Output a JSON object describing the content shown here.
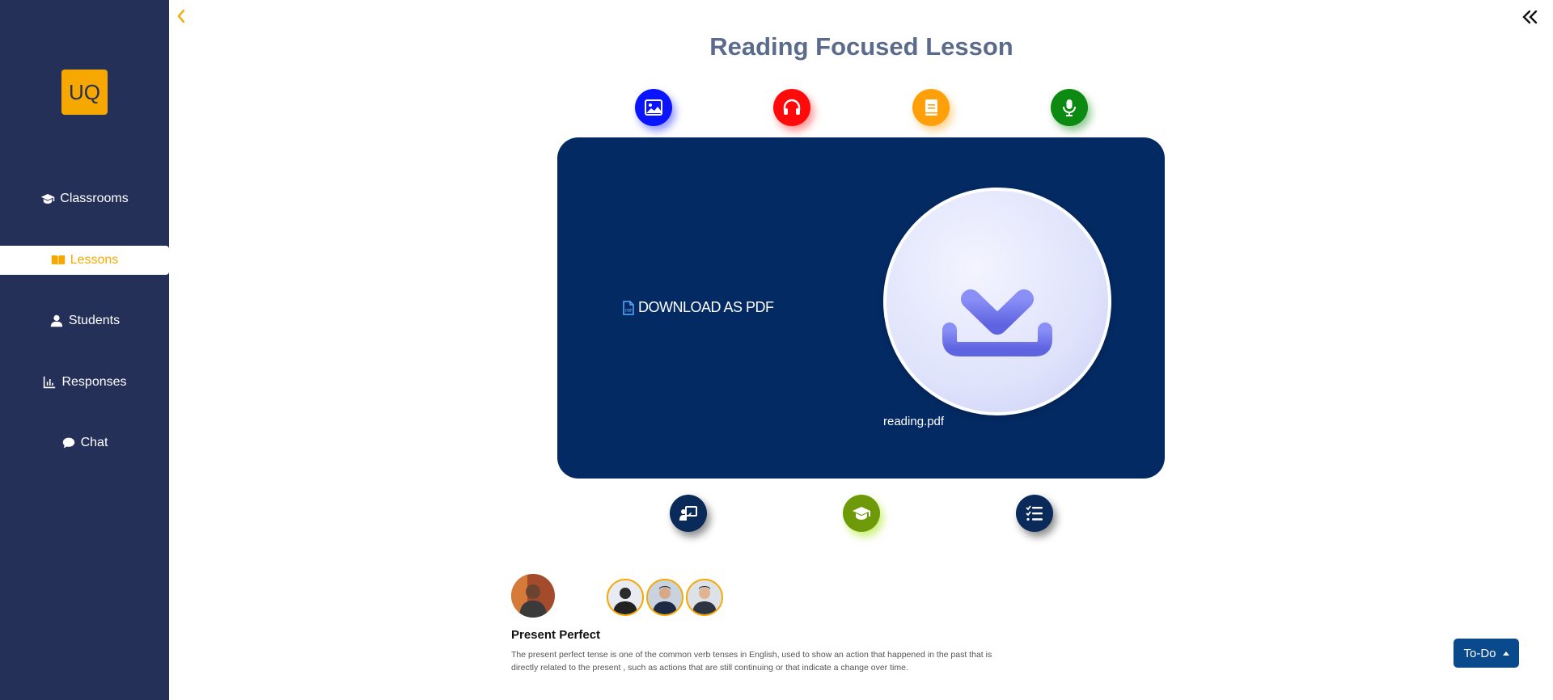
{
  "sidebar": {
    "logo": "UQ",
    "items": [
      {
        "label": "Classrooms",
        "icon": "graduation-cap-icon"
      },
      {
        "label": "Lessons",
        "icon": "book-open-icon",
        "active": true
      },
      {
        "label": "Students",
        "icon": "user-icon"
      },
      {
        "label": "Responses",
        "icon": "chart-bar-icon"
      },
      {
        "label": "Chat",
        "icon": "comment-icon"
      }
    ]
  },
  "page": {
    "title": "Reading Focused Lesson"
  },
  "top_icons": [
    {
      "name": "image-icon",
      "color": "#0a14ff"
    },
    {
      "name": "headphones-icon",
      "color": "#ff0a0a"
    },
    {
      "name": "book-icon",
      "color": "#ff9f0a"
    },
    {
      "name": "microphone-icon",
      "color": "#0d8a12"
    }
  ],
  "card": {
    "download_label": "DOWNLOAD AS PDF",
    "filename": "reading.pdf",
    "background": "#042a63"
  },
  "bottom_icons": [
    {
      "name": "teacher-board-icon",
      "color": "#0a2a5a"
    },
    {
      "name": "graduation-cap-icon",
      "color": "#6e9a0a"
    },
    {
      "name": "task-list-icon",
      "color": "#0a2a5a"
    }
  ],
  "lesson": {
    "title": "Present Perfect",
    "description": "The present perfect tense is one of the common verb tenses in English, used to show an action that happened in the past that is directly related to the present , such as actions that are still continuing or that indicate a change over time."
  },
  "todo": {
    "label": "To-Do"
  },
  "colors": {
    "sidebar_bg": "#253059",
    "accent": "#f7a800",
    "title_text": "#5b6b8c"
  }
}
